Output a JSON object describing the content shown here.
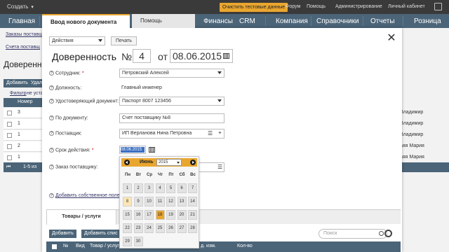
{
  "topbar": {
    "create_label": "Создать",
    "clear_btn": "Очистить тестовые данные",
    "links": [
      "Форум",
      "Помощь",
      "Администрирование",
      "Личный кабинет"
    ]
  },
  "mainnav": {
    "items": [
      "Главная",
      "Финансы",
      "CRM",
      "Компания",
      "Справочники",
      "Отчеты",
      "Розница"
    ]
  },
  "background": {
    "links": [
      "Заказы поставщ",
      "Счета поставщ"
    ],
    "title": "Доверенн",
    "buttons": [
      "Добавить",
      "Удал"
    ],
    "filter_link": "Фильтр",
    "filter_text": "не устан",
    "table_header": "Номер",
    "rows": [
      "3",
      "1",
      "1",
      "2",
      "1"
    ],
    "right_col": [
      "Владимир",
      "Владимир",
      "Владимир",
      "аяя Мария",
      "аяя Мария"
    ],
    "pager": "1-5 из"
  },
  "modal": {
    "tab_active": "Ввод нового документа",
    "tab_inactive": "Помощь",
    "actions_select": "Действия",
    "print_button": "Печать",
    "doc_title": "Доверенность",
    "number_sign": "№",
    "number": "4",
    "date_prefix": "от",
    "date": "08.06.2015",
    "fields": [
      {
        "label": "Сотрудник:",
        "required": true,
        "value": "Петровский Алексей"
      },
      {
        "label": "Должность:",
        "required": false,
        "value": "Главный инженер"
      },
      {
        "label": "Удостоверяющий документ:",
        "required": true,
        "value": "Паспорт 8007 123456"
      },
      {
        "label": "По документу:",
        "required": false,
        "value": "Счет поставщику №8"
      },
      {
        "label": "Поставщик:",
        "required": false,
        "value": "ИП Верланова Нина Петровна"
      },
      {
        "label": "Срок действия:",
        "required": true,
        "value": "08.06.2015"
      },
      {
        "label": "Заказ поставщику:",
        "required": false,
        "value": ""
      }
    ],
    "add_field_link": "Добавить собственное поле",
    "goods_tab": "Товары / услуги",
    "goods_buttons": [
      "Добавить",
      "Добавить спис"
    ],
    "search_placeholder": "Поиск",
    "goods_columns": [
      "№",
      "Вид",
      "Товар / услуг",
      "д. изм.",
      "Кол-во"
    ]
  },
  "calendar": {
    "month": "Июнь",
    "year": "2015",
    "weekdays": [
      "Пн",
      "Вт",
      "Ср",
      "Чт",
      "Пт",
      "Сб",
      "Вс"
    ],
    "weeks": [
      [
        "1",
        "2",
        "3",
        "4",
        "5",
        "6",
        "7"
      ],
      [
        "8",
        "9",
        "10",
        "11",
        "12",
        "13",
        "14"
      ],
      [
        "15",
        "16",
        "17",
        "18",
        "19",
        "20",
        "21"
      ],
      [
        "22",
        "23",
        "24",
        "25",
        "26",
        "27",
        "28"
      ],
      [
        "29",
        "30",
        "",
        "",
        "",
        "",
        ""
      ]
    ],
    "today": "8",
    "selected": "18"
  },
  "colors": {
    "accent": "#e9a62f",
    "nav": "#4b6478",
    "topbar": "#3a3a3a"
  }
}
